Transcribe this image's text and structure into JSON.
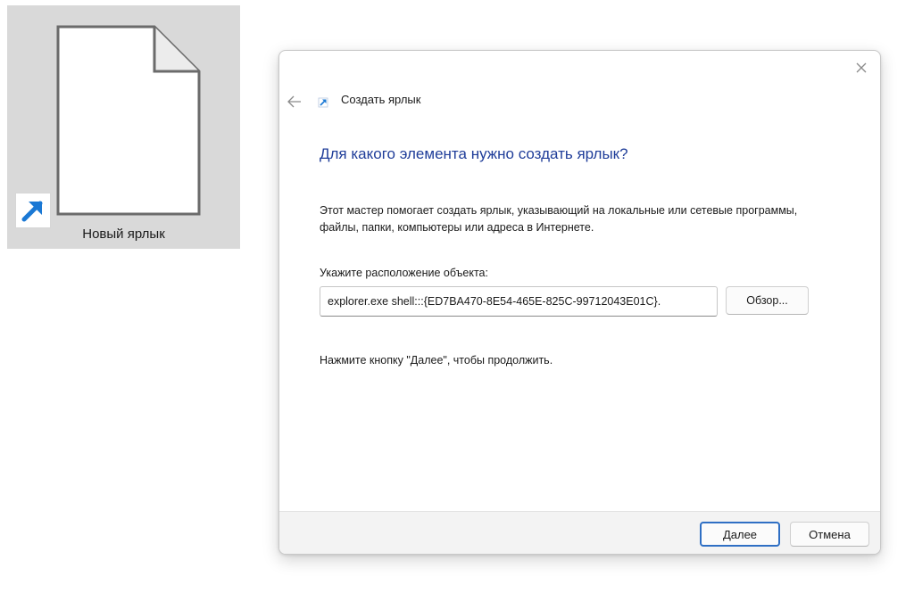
{
  "desktop": {
    "shortcut_label": "Новый ярлык",
    "file_icon": "blank-document-icon",
    "badge_icon": "shortcut-arrow-icon",
    "tile_color": "#d9d9d9",
    "arrow_color": "#1a78d4"
  },
  "wizard": {
    "title": "Создать ярлык",
    "close_icon": "close-icon",
    "back_icon": "back-arrow-icon",
    "title_icon": "shortcut-icon",
    "heading": "Для какого элемента нужно создать ярлык?",
    "heading_color": "#1f3d99",
    "description": "Этот мастер помогает создать ярлык, указывающий на локальные или сетевые программы, файлы, папки, компьютеры или адреса в Интернете.",
    "location_label": "Укажите расположение объекта:",
    "location_value": "explorer.exe shell:::{ED7BA470-8E54-465E-825C-99712043E01C}.",
    "browse_label": "Обзор...",
    "hint": "Нажмите кнопку \"Далее\", чтобы продолжить.",
    "next_label": "Далее",
    "cancel_label": "Отмена",
    "accent_color": "#2f6fc4"
  }
}
